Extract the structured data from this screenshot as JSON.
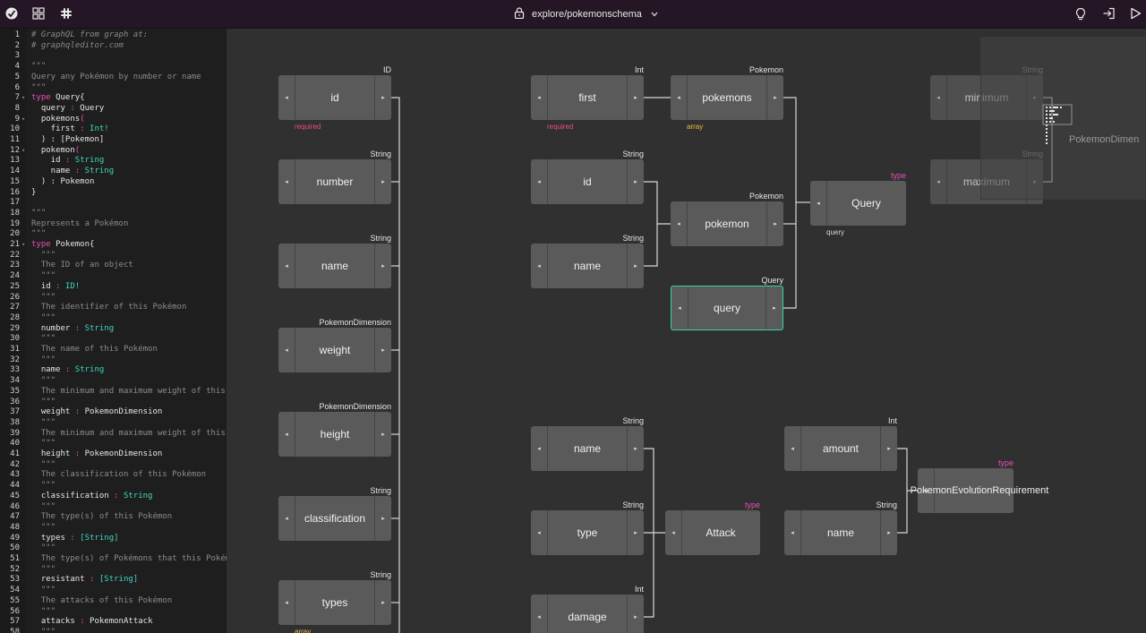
{
  "topbar": {
    "logo_icon": "graphql-editor-logo",
    "grid_icon": "grid-icon",
    "slack_icon": "slack-icon",
    "lock_icon": "lock-icon",
    "project_path": "explore/pokemonschema",
    "bulb_icon": "lightbulb-icon",
    "login_icon": "login-icon",
    "run_icon": "play-icon"
  },
  "code": {
    "lines": [
      {
        "n": "1",
        "text": "# GraphQL from graph at:",
        "kind": "comment"
      },
      {
        "n": "2",
        "text": "# graphqleditor.com",
        "kind": "comment"
      },
      {
        "n": "3",
        "text": "",
        "kind": "desc"
      },
      {
        "n": "4",
        "text": "\"\"\"",
        "kind": "desc"
      },
      {
        "n": "5",
        "text": "Query any Pokémon by number or name",
        "kind": "desc"
      },
      {
        "n": "6",
        "text": "\"\"\"",
        "kind": "desc"
      },
      {
        "n": "7",
        "kw": "type ",
        "name": "Query{",
        "kind": "decl",
        "fold": true
      },
      {
        "n": "8",
        "field": "  query",
        "sep": " : ",
        "type": "Query",
        "kind": "field"
      },
      {
        "n": "9",
        "field": "  pokemons",
        "sep": "(",
        "type": "",
        "kind": "field",
        "fold": true
      },
      {
        "n": "10",
        "field": "    first",
        "sep": " : ",
        "type": "Int!",
        "kind": "fieldscalar"
      },
      {
        "n": "11",
        "text": "  ) : [Pokemon]",
        "kind": "plain"
      },
      {
        "n": "12",
        "field": "  pokemon",
        "sep": "(",
        "type": "",
        "kind": "field",
        "fold": true
      },
      {
        "n": "13",
        "field": "    id",
        "sep": " : ",
        "type": "String",
        "kind": "fieldscalar"
      },
      {
        "n": "14",
        "field": "    name",
        "sep": " : ",
        "type": "String",
        "kind": "fieldscalar"
      },
      {
        "n": "15",
        "text": "  ) : Pokemon",
        "kind": "plain"
      },
      {
        "n": "16",
        "text": "}",
        "kind": "plain"
      },
      {
        "n": "17",
        "text": "",
        "kind": "desc"
      },
      {
        "n": "18",
        "text": "\"\"\"",
        "kind": "desc"
      },
      {
        "n": "19",
        "text": "Represents a Pokémon",
        "kind": "desc"
      },
      {
        "n": "20",
        "text": "\"\"\"",
        "kind": "desc"
      },
      {
        "n": "21",
        "kw": "type ",
        "name": "Pokemon{",
        "kind": "decl",
        "fold": true
      },
      {
        "n": "22",
        "text": "  \"\"\"",
        "kind": "desc"
      },
      {
        "n": "23",
        "text": "  The ID of an object",
        "kind": "desc"
      },
      {
        "n": "24",
        "text": "  \"\"\"",
        "kind": "desc"
      },
      {
        "n": "25",
        "field": "  id",
        "sep": " : ",
        "type": "ID!",
        "kind": "fieldscalar"
      },
      {
        "n": "26",
        "text": "  \"\"\"",
        "kind": "desc"
      },
      {
        "n": "27",
        "text": "  The identifier of this Pokémon",
        "kind": "desc"
      },
      {
        "n": "28",
        "text": "  \"\"\"",
        "kind": "desc"
      },
      {
        "n": "29",
        "field": "  number",
        "sep": " : ",
        "type": "String",
        "kind": "fieldscalar"
      },
      {
        "n": "30",
        "text": "  \"\"\"",
        "kind": "desc"
      },
      {
        "n": "31",
        "text": "  The name of this Pokémon",
        "kind": "desc"
      },
      {
        "n": "32",
        "text": "  \"\"\"",
        "kind": "desc"
      },
      {
        "n": "33",
        "field": "  name",
        "sep": " : ",
        "type": "String",
        "kind": "fieldscalar"
      },
      {
        "n": "34",
        "text": "  \"\"\"",
        "kind": "desc"
      },
      {
        "n": "35",
        "text": "  The minimum and maximum weight of this P",
        "kind": "desc"
      },
      {
        "n": "36",
        "text": "  \"\"\"",
        "kind": "desc"
      },
      {
        "n": "37",
        "field": "  weight",
        "sep": " : ",
        "type": "PokemonDimension",
        "kind": "field"
      },
      {
        "n": "38",
        "text": "  \"\"\"",
        "kind": "desc"
      },
      {
        "n": "39",
        "text": "  The minimum and maximum weight of this P",
        "kind": "desc"
      },
      {
        "n": "40",
        "text": "  \"\"\"",
        "kind": "desc"
      },
      {
        "n": "41",
        "field": "  height",
        "sep": " : ",
        "type": "PokemonDimension",
        "kind": "field"
      },
      {
        "n": "42",
        "text": "  \"\"\"",
        "kind": "desc"
      },
      {
        "n": "43",
        "text": "  The classification of this Pokémon",
        "kind": "desc"
      },
      {
        "n": "44",
        "text": "  \"\"\"",
        "kind": "desc"
      },
      {
        "n": "45",
        "field": "  classification",
        "sep": " : ",
        "type": "String",
        "kind": "fieldscalar"
      },
      {
        "n": "46",
        "text": "  \"\"\"",
        "kind": "desc"
      },
      {
        "n": "47",
        "text": "  The type(s) of this Pokémon",
        "kind": "desc"
      },
      {
        "n": "48",
        "text": "  \"\"\"",
        "kind": "desc"
      },
      {
        "n": "49",
        "field": "  types",
        "sep": " : ",
        "type": "[String]",
        "kind": "fieldscalar"
      },
      {
        "n": "50",
        "text": "  \"\"\"",
        "kind": "desc"
      },
      {
        "n": "51",
        "text": "  The type(s) of Pokémons that this Pokém",
        "kind": "desc"
      },
      {
        "n": "52",
        "text": "  \"\"\"",
        "kind": "desc"
      },
      {
        "n": "53",
        "field": "  resistant",
        "sep": " : ",
        "type": "[String]",
        "kind": "fieldscalar"
      },
      {
        "n": "54",
        "text": "  \"\"\"",
        "kind": "desc"
      },
      {
        "n": "55",
        "text": "  The attacks of this Pokémon",
        "kind": "desc"
      },
      {
        "n": "56",
        "text": "  \"\"\"",
        "kind": "desc"
      },
      {
        "n": "57",
        "field": "  attacks",
        "sep": " : ",
        "type": "PokemonAttack",
        "kind": "field"
      },
      {
        "n": "58",
        "text": "  \"\"\"",
        "kind": "desc"
      }
    ]
  },
  "graph": {
    "nodes": [
      {
        "id": "n-id",
        "label": "id",
        "type_label": "ID",
        "bottom": "required",
        "bottom_kind": "req"
      },
      {
        "id": "n-number",
        "label": "number",
        "type_label": "String",
        "bottom": "",
        "bottom_kind": ""
      },
      {
        "id": "n-name",
        "label": "name",
        "type_label": "String",
        "bottom": "",
        "bottom_kind": ""
      },
      {
        "id": "n-weight",
        "label": "weight",
        "type_label": "PokemonDimension",
        "bottom": "",
        "bottom_kind": ""
      },
      {
        "id": "n-height",
        "label": "height",
        "type_label": "PokemonDimension",
        "bottom": "",
        "bottom_kind": ""
      },
      {
        "id": "n-classification",
        "label": "classification",
        "type_label": "String",
        "bottom": "",
        "bottom_kind": ""
      },
      {
        "id": "n-types",
        "label": "types",
        "type_label": "String",
        "bottom": "array",
        "bottom_kind": "arr"
      },
      {
        "id": "n-first",
        "label": "first",
        "type_label": "Int",
        "bottom": "required",
        "bottom_kind": "req"
      },
      {
        "id": "n-pokemons",
        "label": "pokemons",
        "type_label": "Pokemon",
        "bottom": "array",
        "bottom_kind": "arr"
      },
      {
        "id": "n-pid",
        "label": "id",
        "type_label": "String",
        "bottom": "",
        "bottom_kind": ""
      },
      {
        "id": "n-pokemon",
        "label": "pokemon",
        "type_label": "Pokemon",
        "bottom": "",
        "bottom_kind": ""
      },
      {
        "id": "n-pname",
        "label": "name",
        "type_label": "String",
        "bottom": "",
        "bottom_kind": ""
      },
      {
        "id": "n-query",
        "label": "query",
        "type_label": "Query",
        "bottom": "",
        "bottom_kind": ""
      },
      {
        "id": "n-Query",
        "label": "Query",
        "type_label": "type",
        "bottom": "query",
        "bottom_kind": "plain"
      },
      {
        "id": "n-minimum",
        "label": "minimum",
        "type_label": "String",
        "bottom": "",
        "bottom_kind": ""
      },
      {
        "id": "n-maximum",
        "label": "maximum",
        "type_label": "String",
        "bottom": "",
        "bottom_kind": ""
      },
      {
        "id": "n-aname",
        "label": "name",
        "type_label": "String",
        "bottom": "",
        "bottom_kind": ""
      },
      {
        "id": "n-atype",
        "label": "type",
        "type_label": "String",
        "bottom": "",
        "bottom_kind": ""
      },
      {
        "id": "n-adamage",
        "label": "damage",
        "type_label": "Int",
        "bottom": "",
        "bottom_kind": ""
      },
      {
        "id": "n-Attack",
        "label": "Attack",
        "type_label": "type",
        "bottom": "",
        "bottom_kind": ""
      },
      {
        "id": "n-amount",
        "label": "amount",
        "type_label": "Int",
        "bottom": "",
        "bottom_kind": ""
      },
      {
        "id": "n-rname",
        "label": "name",
        "type_label": "String",
        "bottom": "",
        "bottom_kind": ""
      },
      {
        "id": "n-PER",
        "label": "PokemonEvolutionRequirement",
        "type_label": "type",
        "bottom": "",
        "bottom_kind": ""
      }
    ],
    "minimap_ghost": "PokemonDimen"
  },
  "colors": {
    "topbar_bg": "#241624",
    "editor_bg": "#1e1e1e",
    "graph_bg": "#303030",
    "node_bg": "#5a5a5a",
    "keyword": "#e84fb5",
    "scalar": "#3fd7c0",
    "required": "#e84f7a",
    "array": "#e8c040",
    "selected": "#36d3b0"
  }
}
